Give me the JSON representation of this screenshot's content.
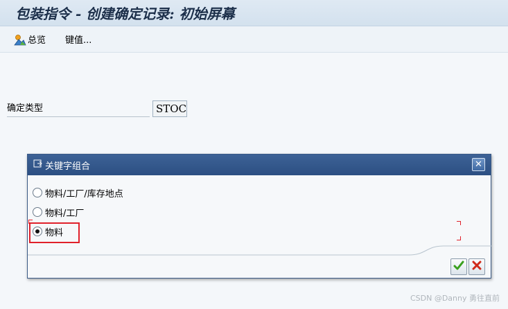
{
  "window": {
    "title": "包装指令 - 创建确定记录: 初始屏幕"
  },
  "toolbar": {
    "overview_label": "总览",
    "keyvalues_label": "键值..."
  },
  "form": {
    "record_type_label": "确定类型",
    "record_type_value": "STOC"
  },
  "dialog": {
    "title": "关键字组合",
    "options": [
      {
        "label": "物料/工厂/库存地点",
        "selected": false
      },
      {
        "label": "物料/工厂",
        "selected": false
      },
      {
        "label": "物料",
        "selected": true
      }
    ],
    "close_glyph": "✕"
  },
  "watermark": "CSDN @Danny 勇往直前",
  "colors": {
    "dialog_header": "#2c4f82",
    "highlight": "#e0202a",
    "confirm": "#3aa01e",
    "cancel": "#d02a1a"
  }
}
